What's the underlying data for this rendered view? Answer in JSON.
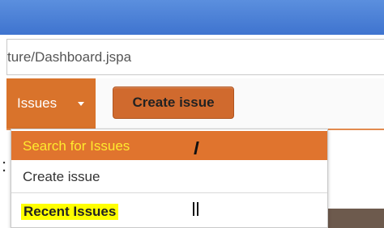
{
  "browser": {
    "url_fragment": "ture/Dashboard.jspa"
  },
  "nav": {
    "issues_label": "Issues",
    "create_issue_label": "Create issue"
  },
  "dropdown": {
    "items": [
      {
        "label": "Search for Issues",
        "state": "highlighted"
      },
      {
        "label": "Create issue"
      },
      {
        "label": "Recent Issues",
        "type": "section-heading"
      }
    ]
  },
  "colors": {
    "accent": "#d9732b",
    "highlight_text": "#ffea2e",
    "recent_highlight": "#ffff00",
    "titlebar": "#4a80d6"
  }
}
